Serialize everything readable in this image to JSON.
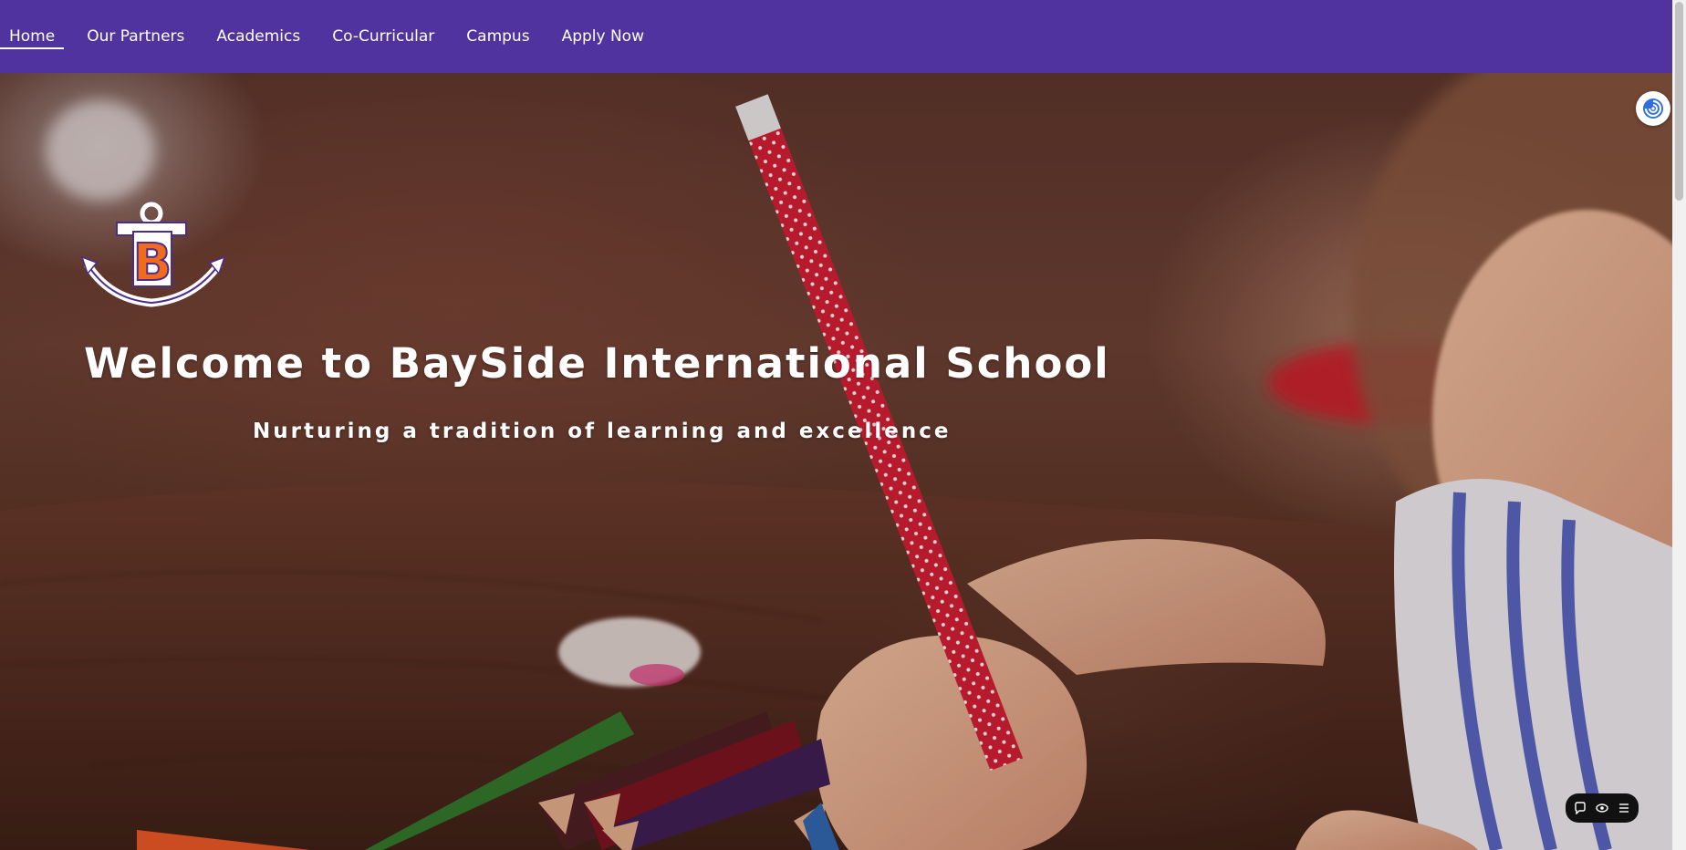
{
  "nav": {
    "items": [
      {
        "label": "Home",
        "active": true
      },
      {
        "label": "Our Partners",
        "active": false
      },
      {
        "label": "Academics",
        "active": false
      },
      {
        "label": "Co-Curricular",
        "active": false
      },
      {
        "label": "Campus",
        "active": false
      },
      {
        "label": "Apply Now",
        "active": false
      }
    ],
    "background_color": "#5133a0"
  },
  "hero": {
    "title": "Welcome to BaySide International School",
    "subtitle": "Nurturing a tradition of learning and excellence",
    "logo": {
      "letter": "B",
      "icon": "anchor-logo-icon",
      "accent_color": "#f26b1d",
      "outline_color": "#4a2d8f"
    }
  },
  "assistant": {
    "icon": "assistant-swirl-icon"
  },
  "toolbar": {
    "icons": [
      "chat-bubble-icon",
      "eye-icon",
      "menu-lines-icon"
    ]
  }
}
